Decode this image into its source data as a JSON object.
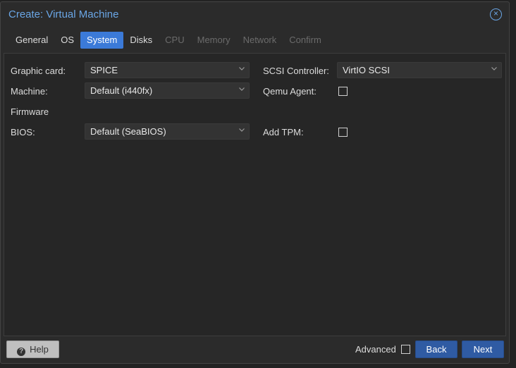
{
  "window": {
    "title": "Create: Virtual Machine"
  },
  "tabs": [
    {
      "label": "General",
      "state": "normal"
    },
    {
      "label": "OS",
      "state": "normal"
    },
    {
      "label": "System",
      "state": "active"
    },
    {
      "label": "Disks",
      "state": "normal"
    },
    {
      "label": "CPU",
      "state": "disabled"
    },
    {
      "label": "Memory",
      "state": "disabled"
    },
    {
      "label": "Network",
      "state": "disabled"
    },
    {
      "label": "Confirm",
      "state": "disabled"
    }
  ],
  "form": {
    "graphic_card": {
      "label": "Graphic card:",
      "value": "SPICE"
    },
    "machine": {
      "label": "Machine:",
      "value": "Default (i440fx)"
    },
    "firmware_heading": "Firmware",
    "bios": {
      "label": "BIOS:",
      "value": "Default (SeaBIOS)"
    },
    "scsi_controller": {
      "label": "SCSI Controller:",
      "value": "VirtIO SCSI"
    },
    "qemu_agent": {
      "label": "Qemu Agent:",
      "checked": false
    },
    "add_tpm": {
      "label": "Add TPM:",
      "checked": false
    }
  },
  "footer": {
    "help_label": "Help",
    "advanced_label": "Advanced",
    "advanced_checked": false,
    "back_label": "Back",
    "next_label": "Next"
  },
  "colors": {
    "accent": "#3b7ad8",
    "title": "#6aa6e6",
    "primary_button": "#2f5ba3"
  },
  "icons": {
    "close": "close-circle-icon",
    "help": "question-circle-icon",
    "dropdown": "chevron-down-icon"
  }
}
